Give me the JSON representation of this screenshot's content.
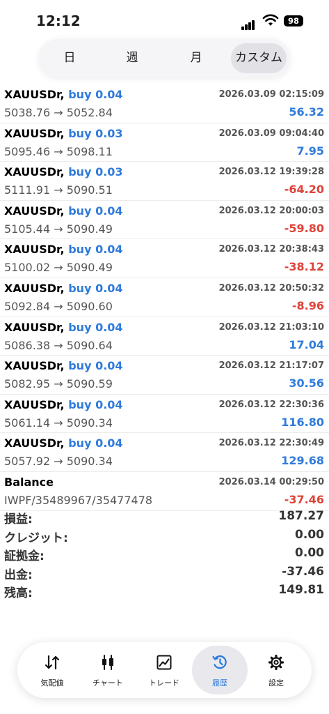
{
  "status": {
    "time": "12:12",
    "battery": "98"
  },
  "tabs": [
    {
      "label": "日"
    },
    {
      "label": "週"
    },
    {
      "label": "月"
    },
    {
      "label": "カスタム",
      "active": true
    }
  ],
  "trades": [
    {
      "symbol": "XAUUSDr,",
      "direction": "buy 0.04",
      "datetime": "2026.03.09 02:15:09",
      "prices": "5038.76 → 5052.84",
      "profit": "56.32",
      "sign": "pos"
    },
    {
      "symbol": "XAUUSDr,",
      "direction": "buy 0.03",
      "datetime": "2026.03.09 09:04:40",
      "prices": "5095.46 → 5098.11",
      "profit": "7.95",
      "sign": "pos"
    },
    {
      "symbol": "XAUUSDr,",
      "direction": "buy 0.03",
      "datetime": "2026.03.12 19:39:28",
      "prices": "5111.91 → 5090.51",
      "profit": "-64.20",
      "sign": "neg"
    },
    {
      "symbol": "XAUUSDr,",
      "direction": "buy 0.04",
      "datetime": "2026.03.12 20:00:03",
      "prices": "5105.44 → 5090.49",
      "profit": "-59.80",
      "sign": "neg"
    },
    {
      "symbol": "XAUUSDr,",
      "direction": "buy 0.04",
      "datetime": "2026.03.12 20:38:43",
      "prices": "5100.02 → 5090.49",
      "profit": "-38.12",
      "sign": "neg"
    },
    {
      "symbol": "XAUUSDr,",
      "direction": "buy 0.04",
      "datetime": "2026.03.12 20:50:32",
      "prices": "5092.84 → 5090.60",
      "profit": "-8.96",
      "sign": "neg"
    },
    {
      "symbol": "XAUUSDr,",
      "direction": "buy 0.04",
      "datetime": "2026.03.12 21:03:10",
      "prices": "5086.38 → 5090.64",
      "profit": "17.04",
      "sign": "pos"
    },
    {
      "symbol": "XAUUSDr,",
      "direction": "buy 0.04",
      "datetime": "2026.03.12 21:17:07",
      "prices": "5082.95 → 5090.59",
      "profit": "30.56",
      "sign": "pos"
    },
    {
      "symbol": "XAUUSDr,",
      "direction": "buy 0.04",
      "datetime": "2026.03.12 22:30:36",
      "prices": "5061.14 → 5090.34",
      "profit": "116.80",
      "sign": "pos"
    },
    {
      "symbol": "XAUUSDr,",
      "direction": "buy 0.04",
      "datetime": "2026.03.12 22:30:49",
      "prices": "5057.92 → 5090.34",
      "profit": "129.68",
      "sign": "pos"
    },
    {
      "symbol": "Balance",
      "direction": "",
      "datetime": "2026.03.14 00:29:50",
      "prices": "IWPF/35489967/35477478",
      "profit": "-37.46",
      "sign": "neg"
    }
  ],
  "summary": [
    {
      "label": "損益:",
      "value": "187.27"
    },
    {
      "label": "クレジット:",
      "value": "0.00"
    },
    {
      "label": "証拠金:",
      "value": "0.00"
    },
    {
      "label": "出金:",
      "value": "-37.46"
    },
    {
      "label": "残高:",
      "value": "149.81"
    }
  ],
  "nav": [
    {
      "label": "気配値",
      "icon": "quotes-arrows-icon"
    },
    {
      "label": "チャート",
      "icon": "candlestick-chart-icon"
    },
    {
      "label": "トレード",
      "icon": "trade-chart-icon"
    },
    {
      "label": "履歴",
      "icon": "history-clock-icon",
      "active": true
    },
    {
      "label": "設定",
      "icon": "gear-icon"
    }
  ],
  "colors": {
    "accent": "#2f7bdc",
    "negative": "#e0433a",
    "text": "#1c1c1e"
  }
}
